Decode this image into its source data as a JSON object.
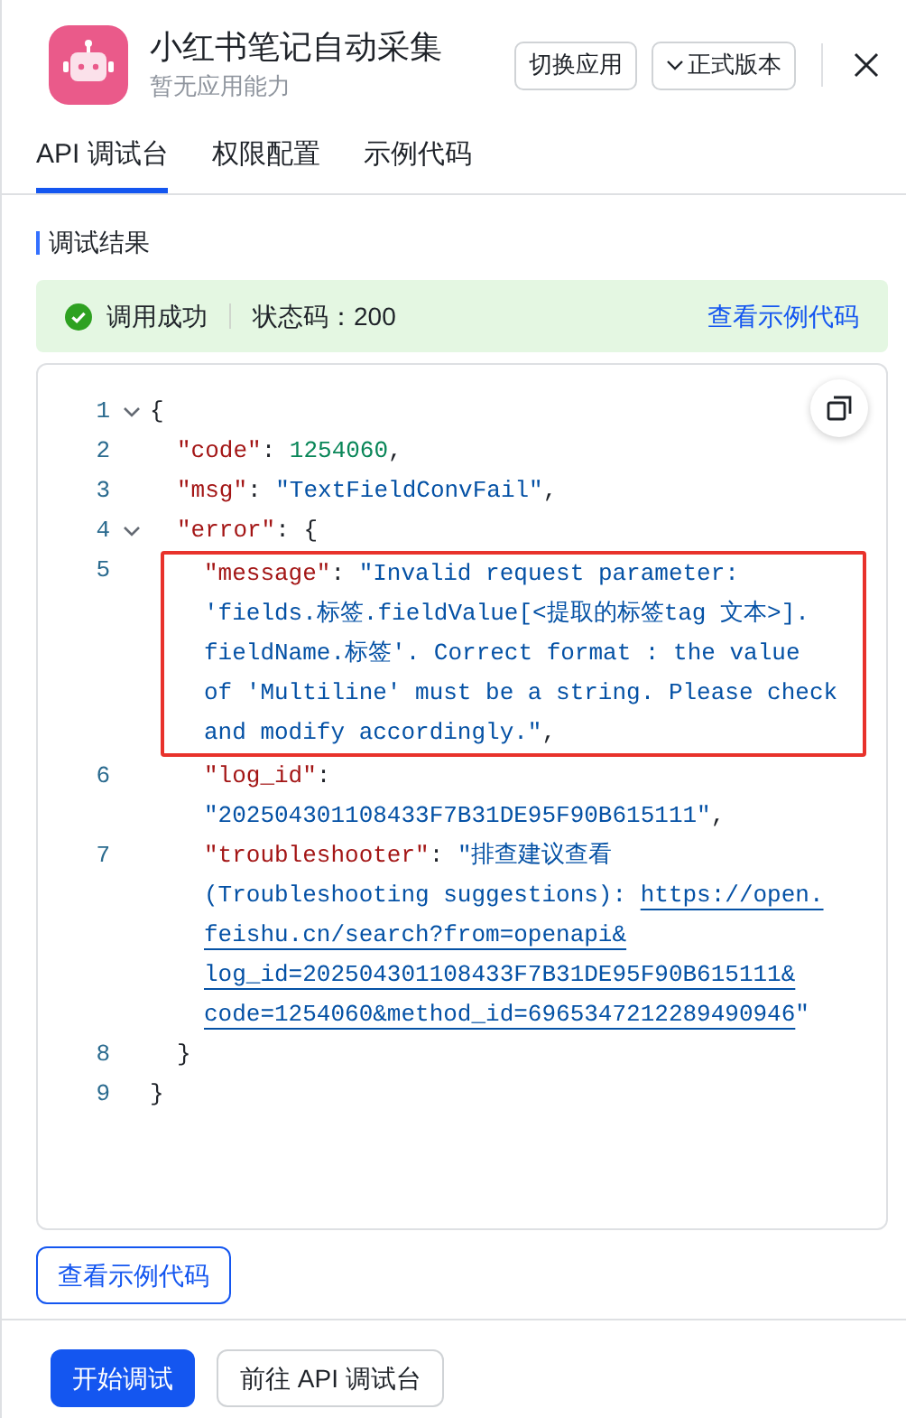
{
  "app": {
    "title": "小红书笔记自动采集",
    "subtitle": "暂无应用能力"
  },
  "header_buttons": [
    {
      "label": "切换应用",
      "kind": "plain"
    },
    {
      "label": "正式版本",
      "kind": "dropdown"
    }
  ],
  "tabs": [
    {
      "label": "API 调试台",
      "selected": true
    },
    {
      "label": "权限配置",
      "selected": false
    },
    {
      "label": "示例代码",
      "selected": false
    }
  ],
  "section_title": "调试结果",
  "result": {
    "status": "调用成功",
    "status_code": "状态码：200",
    "link": "查看示例代码"
  },
  "code": [
    {
      "number": "1",
      "expanded": true,
      "tokens": [
        {
          "kind": "punct",
          "text": "{"
        }
      ],
      "children": [
        {
          "number": "2",
          "tokens": [
            {
              "kind": "key",
              "text": "\"code\""
            },
            {
              "kind": "punct",
              "text": ": "
            },
            {
              "kind": "number",
              "text": "1254060"
            },
            {
              "kind": "punct",
              "text": ","
            }
          ]
        },
        {
          "number": "3",
          "tokens": [
            {
              "kind": "key",
              "text": "\"msg\""
            },
            {
              "kind": "punct",
              "text": ": "
            },
            {
              "kind": "string",
              "text": "\"TextFieldConvFail\""
            },
            {
              "kind": "punct",
              "text": ","
            }
          ]
        },
        {
          "number": "4",
          "expanded": true,
          "tokens": [
            {
              "kind": "key",
              "text": "\"error\""
            },
            {
              "kind": "punct",
              "text": ": {"
            }
          ],
          "children": [
            {
              "number": "5",
              "highlighted": true,
              "tokens": [
                {
                  "kind": "key",
                  "text": "\"message\""
                },
                {
                  "kind": "punct",
                  "text": ": "
                },
                {
                  "kind": "string",
                  "text": "\"Invalid request parameter:"
                },
                {
                  "kind": "break"
                },
                {
                  "kind": "string",
                  "text": "'fields.标签.fieldValue[<提取的标签tag 文本>]."
                },
                {
                  "kind": "break"
                },
                {
                  "kind": "string",
                  "text": "fieldName.标签'. Correct format : the value"
                },
                {
                  "kind": "break"
                },
                {
                  "kind": "string",
                  "text": "of 'Multiline' must be a string. Please check"
                },
                {
                  "kind": "break"
                },
                {
                  "kind": "string",
                  "text": "and modify accordingly.\""
                },
                {
                  "kind": "punct",
                  "text": ","
                }
              ]
            },
            {
              "number": "6",
              "tokens": [
                {
                  "kind": "key",
                  "text": "\"log_id\""
                },
                {
                  "kind": "punct",
                  "text": ":"
                },
                {
                  "kind": "break"
                },
                {
                  "kind": "string",
                  "text": "\"202504301108433F7B31DE95F90B615111\""
                },
                {
                  "kind": "punct",
                  "text": ","
                }
              ]
            },
            {
              "number": "7",
              "tokens": [
                {
                  "kind": "key",
                  "text": "\"troubleshooter\""
                },
                {
                  "kind": "punct",
                  "text": ": "
                },
                {
                  "kind": "string",
                  "text": "\"排查建议查看"
                },
                {
                  "kind": "break"
                },
                {
                  "kind": "string",
                  "text": "(Troubleshooting suggestions): "
                },
                {
                  "kind": "link",
                  "text": "https://open."
                },
                {
                  "kind": "break"
                },
                {
                  "kind": "link",
                  "text": "feishu.cn/search?from=openapi&"
                },
                {
                  "kind": "break"
                },
                {
                  "kind": "link",
                  "text": "log_id=202504301108433F7B31DE95F90B615111&"
                },
                {
                  "kind": "break"
                },
                {
                  "kind": "link",
                  "text": "code=1254060&method_id=6965347212289490946"
                },
                {
                  "kind": "string",
                  "text": "\""
                }
              ]
            }
          ]
        },
        {
          "number": "8",
          "tokens": [
            {
              "kind": "punct",
              "text": "}"
            }
          ]
        }
      ]
    },
    {
      "number": "9",
      "tokens": [
        {
          "kind": "punct",
          "text": "}"
        }
      ]
    }
  ],
  "example_button": "查看示例代码",
  "footer_buttons": [
    {
      "label": "开始调试",
      "kind": "primary"
    },
    {
      "label": "前往 API 调试台",
      "kind": "secondary"
    }
  ]
}
